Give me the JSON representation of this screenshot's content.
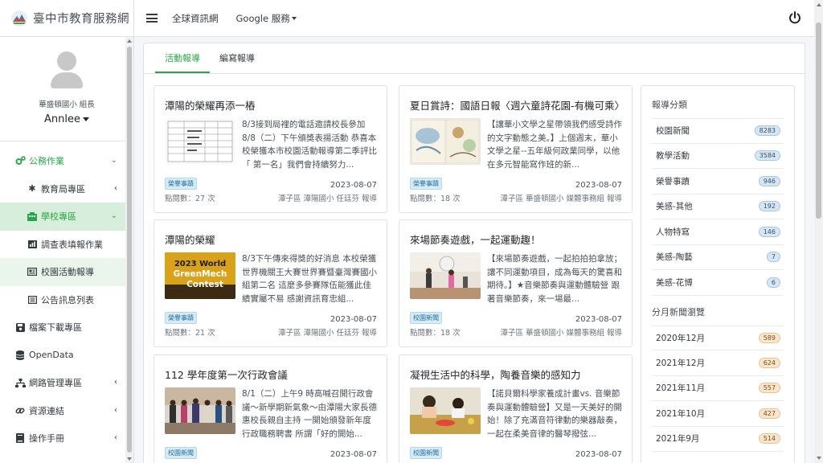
{
  "brand": {
    "name": "臺中市教育服務網"
  },
  "user": {
    "org": "華盛頓國小 組長",
    "name": "Annlee"
  },
  "sidebar": {
    "items": [
      {
        "label": "公務作業"
      },
      {
        "label": "教育局專區"
      },
      {
        "label": "學校專區"
      },
      {
        "label": "調查表填報作業"
      },
      {
        "label": "校園活動報導"
      },
      {
        "label": "公告訊息列表"
      },
      {
        "label": "檔案下載專區"
      },
      {
        "label": "OpenData"
      },
      {
        "label": "網路管理專區"
      },
      {
        "label": "資源連結"
      },
      {
        "label": "操作手冊"
      }
    ]
  },
  "topbar": {
    "link1": "全球資訊網",
    "link2": "Google 服務"
  },
  "tabs": [
    {
      "label": "活動報導"
    },
    {
      "label": "編寫報導"
    }
  ],
  "news": [
    {
      "title": "潭陽的榮耀再添一樁",
      "excerpt": "8/3接到局裡的電話邀請校長參加8/8（二）下午頒獎表揚活動 恭喜本校榮獲本市校園活動報導第二季評比「 第一名」我們會持續努力...",
      "category": "榮譽事蹟",
      "date": "2023-08-07",
      "views": "點閱數：27 次",
      "author": "潭子區 潭陽國小 任廷芬 報導"
    },
    {
      "title": "夏日賞詩：國語日報〈週六童詩花園-有機可乘〉",
      "excerpt": "【讓華小文學之星帶領我們感受詩作的文字動態之美。】上個週末，華小文學之星--五年級何政業同學，以他在多元智能寫作班的新...",
      "category": "榮譽事蹟",
      "date": "2023-08-07",
      "views": "點閱數：18 次",
      "author": "潭子區 華盛頓國小 媒體事務組 報導"
    },
    {
      "title": "潭陽的榮耀",
      "excerpt": "8/3下午傳來得獎的好消息 本校榮獲世界機關王大賽世界賽暨臺灣賽國小組第二名 這麼多參賽隊伍能獲此佳績實屬不易 感謝資訊育忠組...",
      "category": "榮譽事蹟",
      "date": "2023-08-07",
      "views": "點閱數：21 次",
      "author": "潭子區 潭陽國小 任廷芬 報導"
    },
    {
      "title": "來場節奏遊戲，一起運動趣！",
      "excerpt": "【來場節奏遊戲，一起拍拍拍拿放；讓不同運動項目，成為每天的驚喜和期待。】★音樂節奏與運動體驗營 跟著音樂節奏，來一場最...",
      "category": "校園新聞",
      "date": "2023-08-07",
      "views": "點閱數：18 次",
      "author": "潭子區 華盛頓國小 媒體事務組 報導"
    },
    {
      "title": "112 學年度第一次行政會議",
      "excerpt": "8/1（二）上午9 時高喊召開行政會議～新學期新氣象～由潭陽大家長德惠校長親自主持 一開始頒發新年度行政職務聘書 所謂「好的開始...",
      "category": "校園新聞",
      "date": "2023-08-07",
      "views": "",
      "author": ""
    },
    {
      "title": "凝視生活中的科學，陶養音樂的感知力",
      "excerpt": "【諾貝爾科學家養成計畫vs. 音樂節奏與運動體驗營】又是一天美好的開始！除了充滿音符律動的樂器敲奏，一起在柔美音律的醫琴撥弦...",
      "category": "校園新聞",
      "date": "2023-08-07",
      "views": "",
      "author": ""
    }
  ],
  "thumb_text": {
    "contest_line1": "2023 World",
    "contest_line2": "GreenMech",
    "contest_line3": "Contest"
  },
  "categories": {
    "heading": "報導分類",
    "items": [
      {
        "label": "校園新聞",
        "count": "8283"
      },
      {
        "label": "教學活動",
        "count": "3584"
      },
      {
        "label": "榮譽事蹟",
        "count": "946"
      },
      {
        "label": "美感-其他",
        "count": "192"
      },
      {
        "label": "人物特寫",
        "count": "146"
      },
      {
        "label": "美感-陶藝",
        "count": "7"
      },
      {
        "label": "美感-花博",
        "count": "6"
      }
    ]
  },
  "monthly": {
    "heading": "分月新聞瀏覽",
    "items": [
      {
        "label": "2020年12月",
        "count": "589"
      },
      {
        "label": "2021年12月",
        "count": "624"
      },
      {
        "label": "2021年11月",
        "count": "557"
      },
      {
        "label": "2021年10月",
        "count": "427"
      },
      {
        "label": "2021年9月",
        "count": "514"
      }
    ]
  },
  "colors": {
    "accent": "#28a745",
    "badge_blue": "#d6e6f3",
    "badge_orange": "#fbe5cc"
  },
  "icons": [
    "logo-icon",
    "menu-icon",
    "power-icon",
    "briefcase-icon",
    "asterisk-icon",
    "building-icon",
    "chart-icon",
    "newspaper-icon",
    "list-icon",
    "save-icon",
    "database-icon",
    "sitemap-icon",
    "link-icon",
    "book-icon"
  ]
}
